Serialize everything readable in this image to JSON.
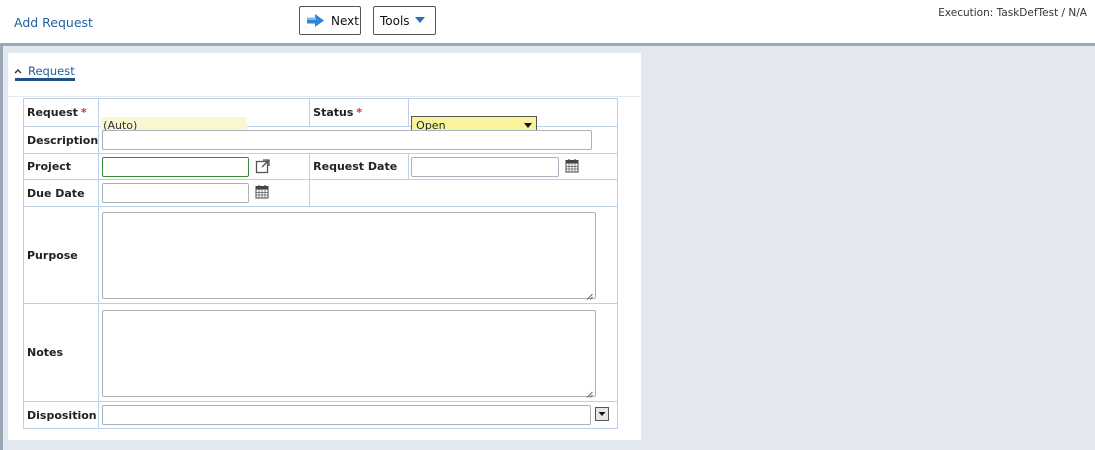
{
  "header": {
    "title": "Add Request",
    "next_label": "Next",
    "tools_label": "Tools",
    "execution": "Execution: TaskDefTest / N/A"
  },
  "section": {
    "tab_label": "Request"
  },
  "form": {
    "request": {
      "label": "Request",
      "value": "(Auto)"
    },
    "status": {
      "label": "Status",
      "value": "Open"
    },
    "description": {
      "label": "Description",
      "value": ""
    },
    "project": {
      "label": "Project",
      "value": ""
    },
    "request_date": {
      "label": "Request Date",
      "value": ""
    },
    "due_date": {
      "label": "Due Date",
      "value": ""
    },
    "purpose": {
      "label": "Purpose",
      "value": ""
    },
    "notes": {
      "label": "Notes",
      "value": ""
    },
    "disposition": {
      "label": "Disposition",
      "value": ""
    }
  },
  "required_marker": "*",
  "icons": {
    "next": "arrow-right-icon",
    "tools": "caret-down-icon",
    "collapse": "chevron-up-icon",
    "project_link": "open-link-icon",
    "calendar": "calendar-icon",
    "dropdown": "dropdown-arrow-icon"
  },
  "colors": {
    "link_blue": "#1f5fa0",
    "required_red": "#d0302a",
    "auto_field_bg": "#fbf6d2",
    "status_bg": "#f8f49c",
    "project_border": "#3a8a3a",
    "workspace_bg": "#e3e8f0"
  }
}
